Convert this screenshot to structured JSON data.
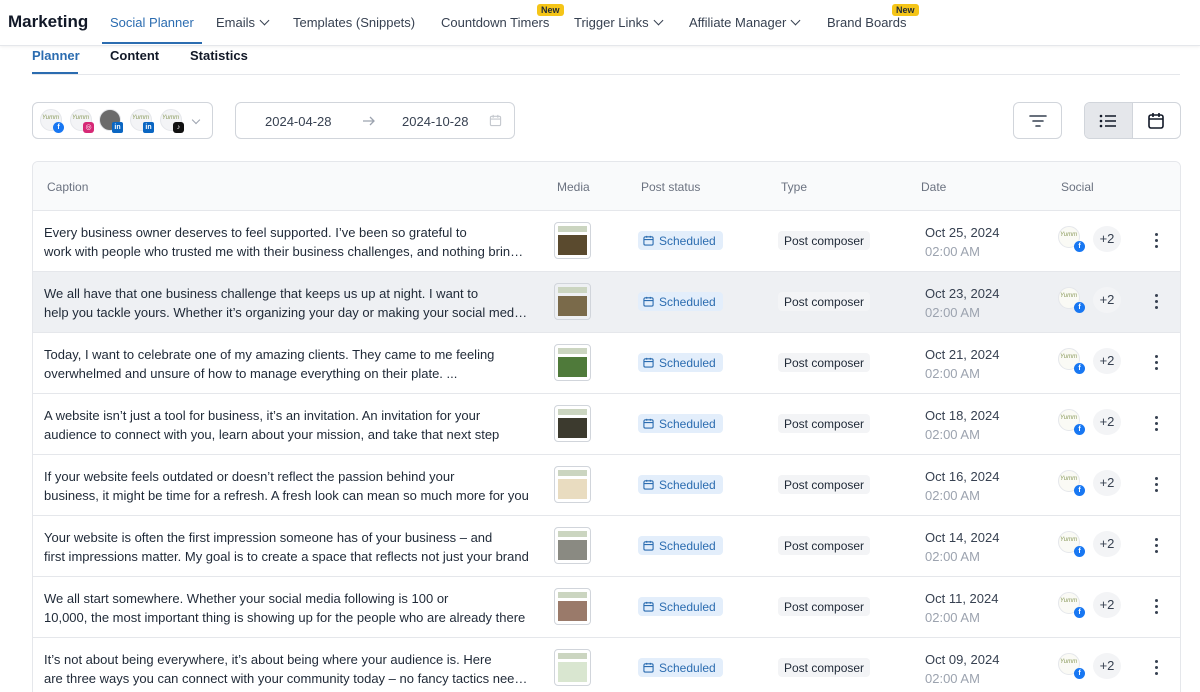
{
  "brand": "Marketing",
  "nav": [
    {
      "label": "Social Planner",
      "active": true
    },
    {
      "label": "Emails",
      "dropdown": true
    },
    {
      "label": "Templates (Snippets)"
    },
    {
      "label": "Countdown Timers",
      "badge": "New"
    },
    {
      "label": "Trigger Links",
      "dropdown": true
    },
    {
      "label": "Affiliate Manager",
      "dropdown": true
    },
    {
      "label": "Brand Boards",
      "badge": "New"
    }
  ],
  "subtabs": [
    {
      "label": "Planner",
      "active": true
    },
    {
      "label": "Content"
    },
    {
      "label": "Statistics"
    }
  ],
  "filters": {
    "accounts": [
      "facebook",
      "instagram",
      "linkedin",
      "linkedin",
      "tiktok"
    ],
    "date_start": "2024-04-28",
    "date_end": "2024-10-28"
  },
  "table": {
    "columns": [
      "Caption",
      "Media",
      "Post status",
      "Type",
      "Date",
      "Social"
    ],
    "rows": [
      {
        "caption1": "Every business owner deserves to feel supported. I’ve been so grateful to",
        "caption2": "work with people who trusted me with their business challenges, and nothing brings me more joy",
        "status": "Scheduled",
        "type": "Post composer",
        "date": "Oct 25, 2024",
        "time": "02:00 AM",
        "extra": "+2",
        "thumb_color": "#5a4a2e"
      },
      {
        "caption1": "We all have that one business challenge that keeps us up at night. I want to",
        "caption2": "help you tackle yours. Whether it’s organizing your day or making your social media work",
        "status": "Scheduled",
        "type": "Post composer",
        "date": "Oct 23, 2024",
        "time": "02:00 AM",
        "extra": "+2",
        "thumb_color": "#7a6a4a"
      },
      {
        "caption1": "Today, I want to celebrate one of my amazing clients. They came to me feeling",
        "caption2": "overwhelmed and unsure of how to manage everything on their plate. ...",
        "status": "Scheduled",
        "type": "Post composer",
        "date": "Oct 21, 2024",
        "time": "02:00 AM",
        "extra": "+2",
        "thumb_color": "#4f7a3a"
      },
      {
        "caption1": "A website isn’t just a tool for business, it’s an invitation. An invitation for your",
        "caption2": "audience to connect with you, learn about your mission, and take that next step",
        "status": "Scheduled",
        "type": "Post composer",
        "date": "Oct 18, 2024",
        "time": "02:00 AM",
        "extra": "+2",
        "thumb_color": "#3c3a2e"
      },
      {
        "caption1": "If your website feels outdated or doesn’t reflect the passion behind your",
        "caption2": "business, it might be time for a refresh. A fresh look can mean so much more for you",
        "status": "Scheduled",
        "type": "Post composer",
        "date": "Oct 16, 2024",
        "time": "02:00 AM",
        "extra": "+2",
        "thumb_color": "#e9dcc0"
      },
      {
        "caption1": "Your website is often the first impression someone has of your business – and",
        "caption2": "first impressions matter. My goal is to create a space that reflects not just your brand",
        "status": "Scheduled",
        "type": "Post composer",
        "date": "Oct 14, 2024",
        "time": "02:00 AM",
        "extra": "+2",
        "thumb_color": "#8a8a82"
      },
      {
        "caption1": "We all start somewhere. Whether your social media following is 100 or",
        "caption2": "10,000, the most important thing is showing up for the people who are already there",
        "status": "Scheduled",
        "type": "Post composer",
        "date": "Oct 11, 2024",
        "time": "02:00 AM",
        "extra": "+2",
        "thumb_color": "#9a7a6a"
      },
      {
        "caption1": "It’s not about being everywhere, it’s about being where your audience is. Here",
        "caption2": "are three ways you can connect with your community today – no fancy tactics needed",
        "status": "Scheduled",
        "type": "Post composer",
        "date": "Oct 09, 2024",
        "time": "02:00 AM",
        "extra": "+2",
        "thumb_color": "#d9e6d0"
      }
    ]
  },
  "colors": {
    "accent": "#2b6cb0",
    "status_bg": "#e3eefb",
    "badge": "#f5c518"
  }
}
